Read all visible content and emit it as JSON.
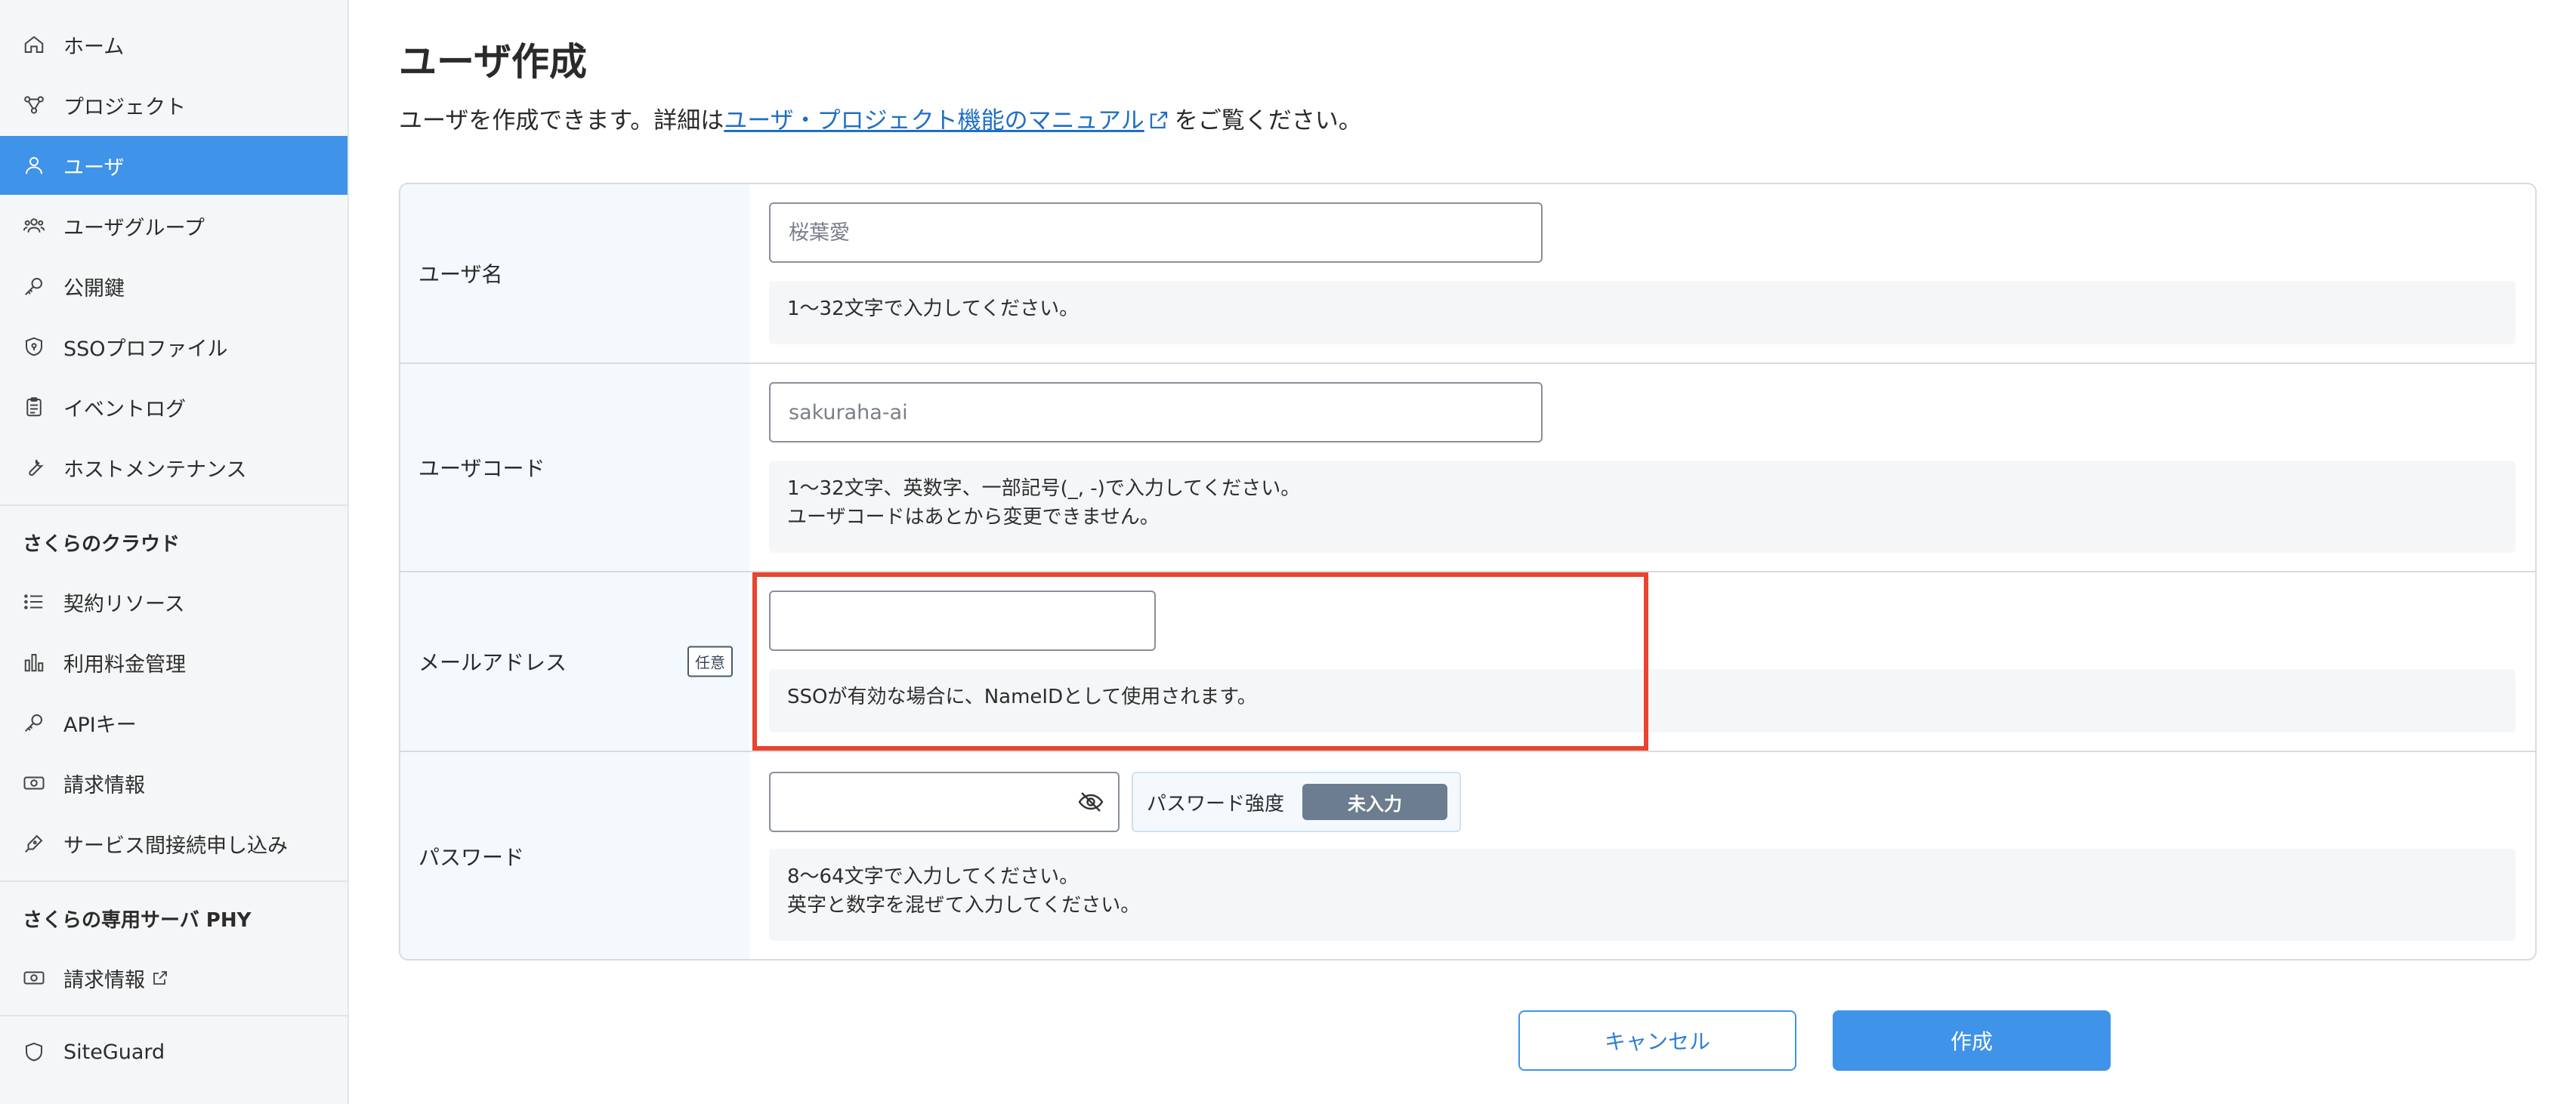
{
  "sidebar": {
    "items": [
      {
        "label": "ホーム",
        "icon": "home-icon"
      },
      {
        "label": "プロジェクト",
        "icon": "project-icon"
      },
      {
        "label": "ユーザ",
        "icon": "user-icon",
        "active": true
      },
      {
        "label": "ユーザグループ",
        "icon": "user-group-icon"
      },
      {
        "label": "公開鍵",
        "icon": "key-icon"
      },
      {
        "label": "SSOプロファイル",
        "icon": "shield-icon"
      },
      {
        "label": "イベントログ",
        "icon": "clipboard-icon"
      },
      {
        "label": "ホストメンテナンス",
        "icon": "wrench-icon"
      }
    ],
    "section_cloud": {
      "title": "さくらのクラウド",
      "items": [
        {
          "label": "契約リソース",
          "icon": "list-icon"
        },
        {
          "label": "利用料金管理",
          "icon": "bar-chart-icon"
        },
        {
          "label": "APIキー",
          "icon": "api-key-icon"
        },
        {
          "label": "請求情報",
          "icon": "money-icon"
        },
        {
          "label": "サービス間接続申し込み",
          "icon": "pen-icon"
        }
      ]
    },
    "section_phy": {
      "title": "さくらの専用サーバ PHY",
      "items": [
        {
          "label": "請求情報",
          "icon": "money-icon",
          "external": true
        }
      ]
    },
    "siteguard": {
      "label": "SiteGuard",
      "icon": "shield-outline-icon"
    }
  },
  "page": {
    "title": "ユーザ作成",
    "desc_prefix": "ユーザを作成できます。詳細は",
    "desc_link": "ユーザ・プロジェクト機能のマニュアル",
    "desc_suffix": "をご覧ください。"
  },
  "form": {
    "username": {
      "label": "ユーザ名",
      "placeholder": "桜葉愛",
      "help": "1〜32文字で入力してください。"
    },
    "usercode": {
      "label": "ユーザコード",
      "placeholder": "sakuraha-ai",
      "help_line1": "1〜32文字、英数字、一部記号(_, -)で入力してください。",
      "help_line2": "ユーザコードはあとから変更できません。"
    },
    "email": {
      "label": "メールアドレス",
      "badge": "任意",
      "value": "",
      "help": "SSOが有効な場合に、NameIDとして使用されます。"
    },
    "password": {
      "label": "パスワード",
      "value": "",
      "strength_label": "パスワード強度",
      "strength_value": "未入力",
      "help_line1": "8〜64文字で入力してください。",
      "help_line2": "英字と数字を混ぜて入力してください。"
    }
  },
  "buttons": {
    "cancel": "キャンセル",
    "create": "作成"
  },
  "colors": {
    "accent": "#3f93e8",
    "highlight": "#e8442f",
    "badge_gray": "#6b7d8e"
  }
}
